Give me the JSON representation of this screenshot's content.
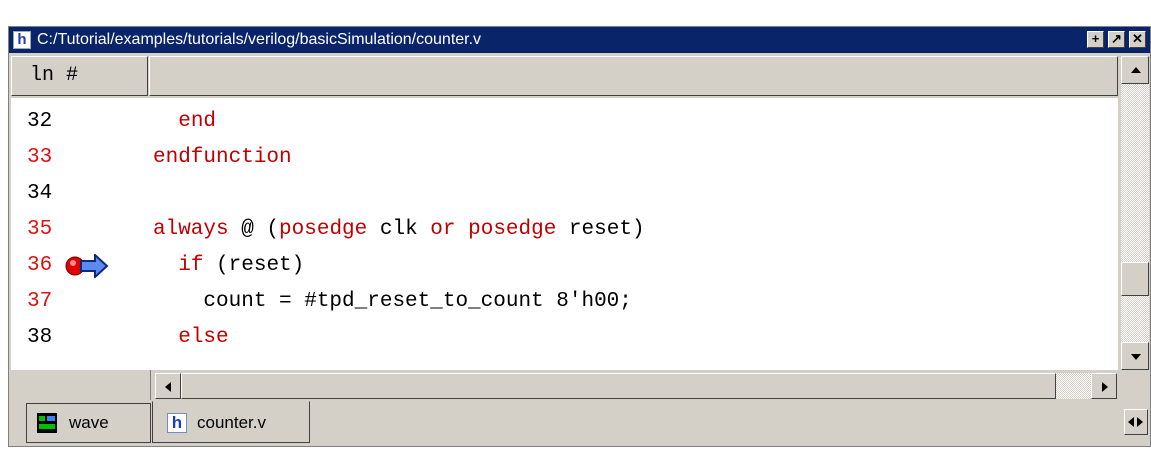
{
  "window": {
    "icon": "h-file-icon",
    "title": "C:/Tutorial/examples/tutorials/verilog/basicSimulation/counter.v",
    "buttons": {
      "maximize": "+",
      "float": "↗",
      "close": "✕"
    }
  },
  "header": {
    "ln_label": "ln #"
  },
  "code": {
    "keyword_color": "#c00000",
    "lines": [
      {
        "num": "32",
        "text": "  end",
        "num_red": false
      },
      {
        "num": "33",
        "text": "endfunction",
        "num_red": true
      },
      {
        "num": "34",
        "text": "",
        "num_red": false
      },
      {
        "num": "35",
        "text": "always @ (posedge clk or posedge reset)",
        "num_red": true
      },
      {
        "num": "36",
        "text": "  if (reset)",
        "num_red": true,
        "current": true
      },
      {
        "num": "37",
        "text": "    count = #tpd_reset_to_count 8'h00;",
        "num_red": true
      },
      {
        "num": "38",
        "text": "  else",
        "num_red": false
      }
    ]
  },
  "tabs": [
    {
      "label": "wave",
      "icon": "wave-window-icon",
      "active": false
    },
    {
      "label": "counter.v",
      "icon": "h-file-icon",
      "active": true
    }
  ]
}
